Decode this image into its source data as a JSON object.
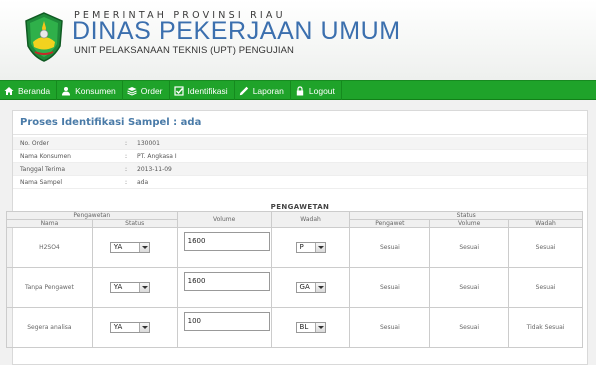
{
  "header": {
    "line1": "PEMERINTAH PROVINSI RIAU",
    "line2": "DINAS PEKERJAAN UMUM",
    "line3": "UNIT PELAKSANAAN TEKNIS (UPT) PENGUJIAN"
  },
  "nav": {
    "items": [
      {
        "label": "Beranda",
        "icon": "home-icon"
      },
      {
        "label": "Konsumen",
        "icon": "users-icon"
      },
      {
        "label": "Order",
        "icon": "stack-icon"
      },
      {
        "label": "Identifikasi",
        "icon": "checkbox-icon"
      },
      {
        "label": "Laporan",
        "icon": "pencil-icon"
      },
      {
        "label": "Logout",
        "icon": "lock-icon"
      }
    ]
  },
  "page": {
    "title": "Proses Identifikasi Sampel : ada",
    "section_title": "PENGAWETAN"
  },
  "info": [
    {
      "label": "No. Order",
      "value": "130001"
    },
    {
      "label": "Nama Konsumen",
      "value": "PT. Angkasa I"
    },
    {
      "label": "Tanggal Terima",
      "value": "2013-11-09"
    },
    {
      "label": "Nama Sampel",
      "value": "ada"
    }
  ],
  "table": {
    "group_headers": {
      "pengawetan": "Pengawetan",
      "volume": "Volume",
      "wadah": "Wadah",
      "status": "Status"
    },
    "sub_headers": {
      "nama": "Nama",
      "status": "Status",
      "pengawet": "Pengawet",
      "volume": "Volume",
      "wadah": "Wadah"
    },
    "rows": [
      {
        "nama": "H2SO4",
        "status": "YA",
        "volume": "1600",
        "wadah": "P",
        "s_pengawet": "Sesuai",
        "s_volume": "Sesuai",
        "s_wadah": "Sesuai"
      },
      {
        "nama": "Tanpa Pengawet",
        "status": "YA",
        "volume": "1600",
        "wadah": "GA",
        "s_pengawet": "Sesuai",
        "s_volume": "Sesuai",
        "s_wadah": "Sesuai"
      },
      {
        "nama": "Segera analisa",
        "status": "YA",
        "volume": "100",
        "wadah": "BL",
        "s_pengawet": "Sesuai",
        "s_volume": "Sesuai",
        "s_wadah": "Tidak Sesuai"
      }
    ]
  }
}
